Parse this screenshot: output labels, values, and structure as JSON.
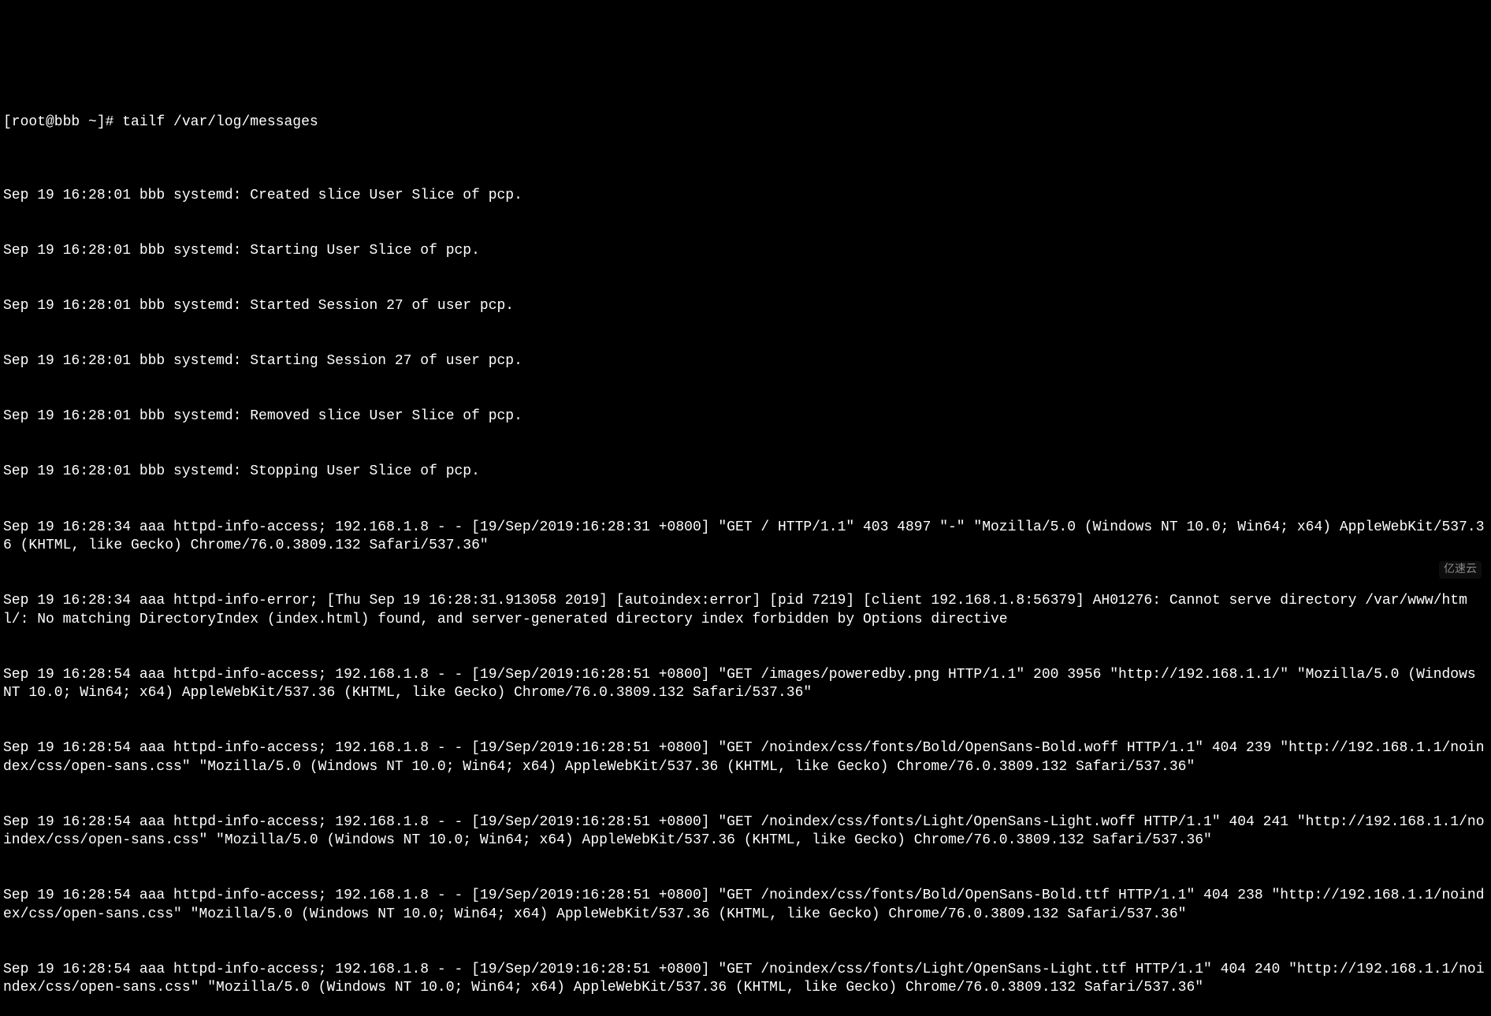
{
  "terminal": {
    "prompt": "[root@bbb ~]# ",
    "command": "tailf /var/log/messages",
    "lines": [
      "Sep 19 16:28:01 bbb systemd: Created slice User Slice of pcp.",
      "Sep 19 16:28:01 bbb systemd: Starting User Slice of pcp.",
      "Sep 19 16:28:01 bbb systemd: Started Session 27 of user pcp.",
      "Sep 19 16:28:01 bbb systemd: Starting Session 27 of user pcp.",
      "Sep 19 16:28:01 bbb systemd: Removed slice User Slice of pcp.",
      "Sep 19 16:28:01 bbb systemd: Stopping User Slice of pcp.",
      "Sep 19 16:28:34 aaa httpd-info-access; 192.168.1.8 - - [19/Sep/2019:16:28:31 +0800] \"GET / HTTP/1.1\" 403 4897 \"-\" \"Mozilla/5.0 (Windows NT 10.0; Win64; x64) AppleWebKit/537.36 (KHTML, like Gecko) Chrome/76.0.3809.132 Safari/537.36\"",
      "Sep 19 16:28:34 aaa httpd-info-error; [Thu Sep 19 16:28:31.913058 2019] [autoindex:error] [pid 7219] [client 192.168.1.8:56379] AH01276: Cannot serve directory /var/www/html/: No matching DirectoryIndex (index.html) found, and server-generated directory index forbidden by Options directive",
      "Sep 19 16:28:54 aaa httpd-info-access; 192.168.1.8 - - [19/Sep/2019:16:28:51 +0800] \"GET /images/poweredby.png HTTP/1.1\" 200 3956 \"http://192.168.1.1/\" \"Mozilla/5.0 (Windows NT 10.0; Win64; x64) AppleWebKit/537.36 (KHTML, like Gecko) Chrome/76.0.3809.132 Safari/537.36\"",
      "Sep 19 16:28:54 aaa httpd-info-access; 192.168.1.8 - - [19/Sep/2019:16:28:51 +0800] \"GET /noindex/css/fonts/Bold/OpenSans-Bold.woff HTTP/1.1\" 404 239 \"http://192.168.1.1/noindex/css/open-sans.css\" \"Mozilla/5.0 (Windows NT 10.0; Win64; x64) AppleWebKit/537.36 (KHTML, like Gecko) Chrome/76.0.3809.132 Safari/537.36\"",
      "Sep 19 16:28:54 aaa httpd-info-access; 192.168.1.8 - - [19/Sep/2019:16:28:51 +0800] \"GET /noindex/css/fonts/Light/OpenSans-Light.woff HTTP/1.1\" 404 241 \"http://192.168.1.1/noindex/css/open-sans.css\" \"Mozilla/5.0 (Windows NT 10.0; Win64; x64) AppleWebKit/537.36 (KHTML, like Gecko) Chrome/76.0.3809.132 Safari/537.36\"",
      "Sep 19 16:28:54 aaa httpd-info-access; 192.168.1.8 - - [19/Sep/2019:16:28:51 +0800] \"GET /noindex/css/fonts/Bold/OpenSans-Bold.ttf HTTP/1.1\" 404 238 \"http://192.168.1.1/noindex/css/open-sans.css\" \"Mozilla/5.0 (Windows NT 10.0; Win64; x64) AppleWebKit/537.36 (KHTML, like Gecko) Chrome/76.0.3809.132 Safari/537.36\"",
      "Sep 19 16:28:54 aaa httpd-info-access; 192.168.1.8 - - [19/Sep/2019:16:28:51 +0800] \"GET /noindex/css/fonts/Light/OpenSans-Light.ttf HTTP/1.1\" 404 240 \"http://192.168.1.1/noindex/css/open-sans.css\" \"Mozilla/5.0 (Windows NT 10.0; Win64; x64) AppleWebKit/537.36 (KHTML, like Gecko) Chrome/76.0.3809.132 Safari/537.36\""
    ]
  },
  "watermark": "亿速云"
}
